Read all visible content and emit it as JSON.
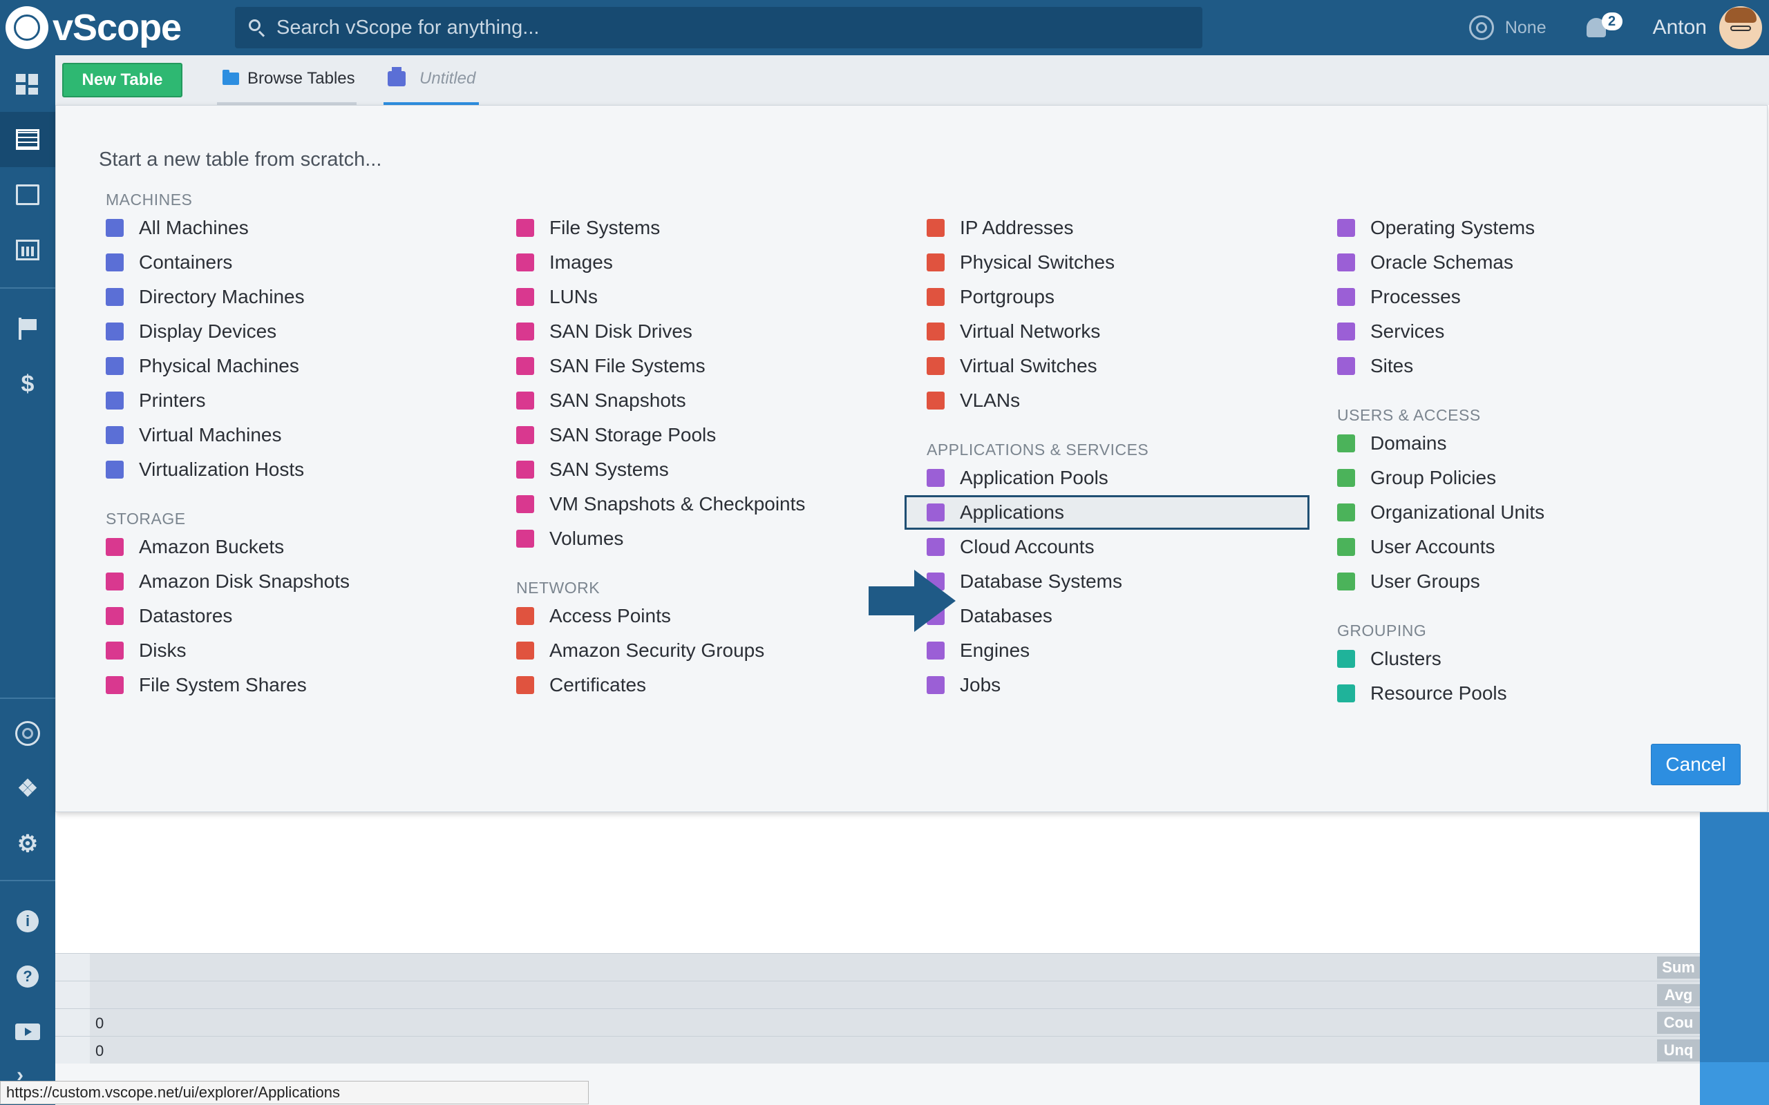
{
  "app": {
    "name": "vScope"
  },
  "search": {
    "placeholder": "Search vScope for anything..."
  },
  "header": {
    "tracker_label": "None",
    "notification_count": "2",
    "user_name": "Anton"
  },
  "toolbar": {
    "new_table_label": "New Table",
    "tabs": [
      {
        "label": "Browse Tables",
        "icon": "folder-icon"
      },
      {
        "label": "Untitled",
        "icon": "printer-icon",
        "active": true
      }
    ]
  },
  "dialog": {
    "title": "Start a new table from scratch...",
    "columns": [
      {
        "sections": [
          {
            "label": "MACHINES",
            "items": [
              "All Machines",
              "Containers",
              "Directory Machines",
              "Display Devices",
              "Physical Machines",
              "Printers",
              "Virtual Machines",
              "Virtualization Hosts"
            ]
          },
          {
            "label": "STORAGE",
            "items": [
              "Amazon Buckets",
              "Amazon Disk Snapshots",
              "Datastores",
              "Disks",
              "File System Shares"
            ]
          }
        ]
      },
      {
        "sections": [
          {
            "label": "",
            "items": [
              "File Systems",
              "Images",
              "LUNs",
              "SAN Disk Drives",
              "SAN File Systems",
              "SAN Snapshots",
              "SAN Storage Pools",
              "SAN Systems",
              "VM Snapshots & Checkpoints",
              "Volumes"
            ]
          },
          {
            "label": "NETWORK",
            "items": [
              "Access Points",
              "Amazon Security Groups",
              "Certificates"
            ]
          }
        ]
      },
      {
        "sections": [
          {
            "label": "",
            "items": [
              "IP Addresses",
              "Physical Switches",
              "Portgroups",
              "Virtual Networks",
              "Virtual Switches",
              "VLANs"
            ]
          },
          {
            "label": "APPLICATIONS & SERVICES",
            "items": [
              "Application Pools",
              "Applications",
              "Cloud Accounts",
              "Database Systems",
              "Databases",
              "Engines",
              "Jobs"
            ]
          }
        ]
      },
      {
        "sections": [
          {
            "label": "",
            "items": [
              "Operating Systems",
              "Oracle Schemas",
              "Processes",
              "Services",
              "Sites"
            ]
          },
          {
            "label": "USERS & ACCESS",
            "items": [
              "Domains",
              "Group Policies",
              "Organizational Units",
              "User Accounts",
              "User Groups"
            ]
          },
          {
            "label": "GROUPING",
            "items": [
              "Clusters",
              "Resource Pools"
            ]
          }
        ]
      }
    ],
    "highlighted_item": "Applications",
    "cancel_label": "Cancel"
  },
  "summary": {
    "rows": [
      {
        "value": "",
        "label": "Sum"
      },
      {
        "value": "",
        "label": "Avg"
      },
      {
        "value": "0",
        "label": "Cou"
      },
      {
        "value": "0",
        "label": "Unq"
      }
    ]
  },
  "status_url": "https://custom.vscope.net/ui/explorer/Applications",
  "colors": {
    "brand": "#1f5a86",
    "accent": "#2d8ee0",
    "primary_action": "#2eb872",
    "machines": "#5b6fd6",
    "storage": "#d9388f",
    "network": "#e0533f",
    "apps": "#9b5fd6",
    "users": "#4bb35a",
    "grouping": "#1fb39a"
  }
}
